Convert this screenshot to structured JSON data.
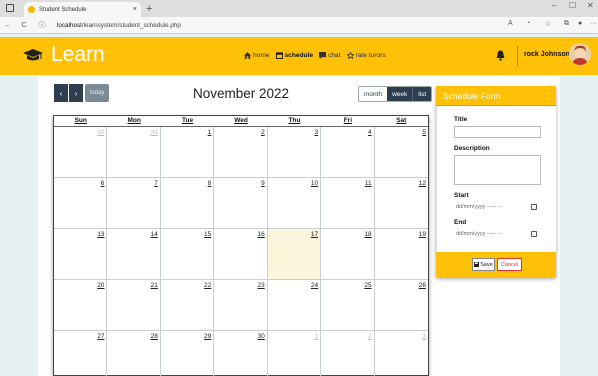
{
  "browser": {
    "tab_title": "Student Schedule",
    "tab_close": "×",
    "new_tab": "+",
    "url_host": "localhost",
    "url_path": "/learnsystem/student_schedule.php",
    "minimize": "–",
    "maximize": "☐",
    "close": "✕",
    "back": "←",
    "reload": "C",
    "info": "ⓘ",
    "more": "···"
  },
  "header": {
    "brand": "Learn",
    "menu": [
      {
        "label": "home",
        "icon": "home-icon"
      },
      {
        "label": "schedule",
        "icon": "calendar-icon",
        "active": true
      },
      {
        "label": "chat",
        "icon": "chat-icon"
      },
      {
        "label": "rate turors",
        "icon": "star-icon"
      }
    ],
    "user": "rock Johnson",
    "accent": "#ffc107"
  },
  "calendar": {
    "title": "November 2022",
    "today_label": "today",
    "prev": "‹",
    "next": "›",
    "views": [
      "month",
      "week",
      "list"
    ],
    "weekdays": [
      "Sun",
      "Mon",
      "Tue",
      "Wed",
      "Thu",
      "Fri",
      "Sat"
    ],
    "days": [
      {
        "n": "30",
        "other": true
      },
      {
        "n": "31",
        "other": true
      },
      {
        "n": "1"
      },
      {
        "n": "2"
      },
      {
        "n": "3"
      },
      {
        "n": "4"
      },
      {
        "n": "5"
      },
      {
        "n": "6"
      },
      {
        "n": "7"
      },
      {
        "n": "8"
      },
      {
        "n": "9"
      },
      {
        "n": "10"
      },
      {
        "n": "11"
      },
      {
        "n": "12"
      },
      {
        "n": "13"
      },
      {
        "n": "14"
      },
      {
        "n": "15"
      },
      {
        "n": "16"
      },
      {
        "n": "17",
        "today": true
      },
      {
        "n": "18"
      },
      {
        "n": "19"
      },
      {
        "n": "20"
      },
      {
        "n": "21"
      },
      {
        "n": "22"
      },
      {
        "n": "23"
      },
      {
        "n": "24"
      },
      {
        "n": "25"
      },
      {
        "n": "26"
      },
      {
        "n": "27"
      },
      {
        "n": "28"
      },
      {
        "n": "29"
      },
      {
        "n": "30"
      },
      {
        "n": "1",
        "other": true
      },
      {
        "n": "2",
        "other": true
      },
      {
        "n": "3",
        "other": true
      }
    ]
  },
  "form": {
    "heading": "Schedule Form",
    "title_label": "Title",
    "title_value": "",
    "description_label": "Description",
    "description_value": "",
    "start_label": "Start",
    "start_placeholder": "dd/mm/yyyy --:-- --",
    "end_label": "End",
    "end_placeholder": "dd/mm/yyyy --:-- --",
    "save_label": "Save",
    "cancel_label": "Cancel"
  }
}
